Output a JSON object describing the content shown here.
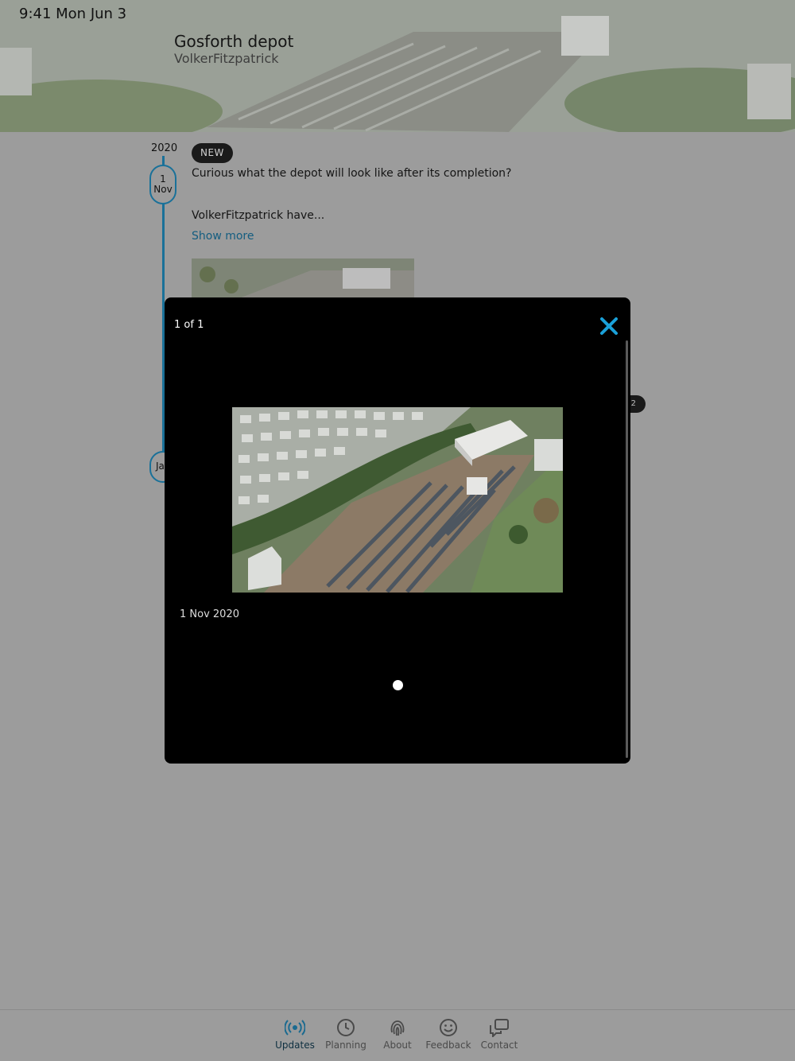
{
  "status_bar": {
    "time": "9:41  Mon Jun 3"
  },
  "header": {
    "title": "Gosforth depot",
    "subtitle": "VolkerFitzpatrick"
  },
  "timeline": {
    "year": "2020",
    "entries": [
      {
        "date_day": "1",
        "date_month": "Nov",
        "badge": "NEW",
        "question": "Curious what the depot will look like after its completion?",
        "excerpt": "VolkerFitzpatrick have...",
        "show_more": "Show more"
      },
      {
        "date_partial": "Ja"
      }
    ],
    "image_count_badge": "2"
  },
  "lightbox": {
    "counter": "1 of 1",
    "caption": "1 Nov 2020",
    "page_dots": 1,
    "accent_color": "#1aa0d8"
  },
  "tabbar": {
    "active_color": "#1a6a90",
    "items": [
      {
        "label": "Updates",
        "icon": "broadcast-icon",
        "active": true
      },
      {
        "label": "Planning",
        "icon": "clock-icon",
        "active": false
      },
      {
        "label": "About",
        "icon": "fingerprint-icon",
        "active": false
      },
      {
        "label": "Feedback",
        "icon": "smiley-icon",
        "active": false
      },
      {
        "label": "Contact",
        "icon": "chat-bubbles-icon",
        "active": false
      }
    ]
  }
}
